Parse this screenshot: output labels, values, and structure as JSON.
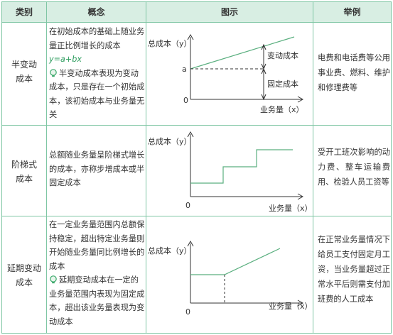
{
  "headers": {
    "category": "类别",
    "concept": "概念",
    "diagram": "图示",
    "example": "举例"
  },
  "rows": [
    {
      "category": [
        "半变动",
        "成本"
      ],
      "concept": "在初始成本的基础上随业务量正比例增长的成本",
      "formula": "y=a+bx",
      "tip": "半变动成本表现为变动成本，只是存在一个初始成本，该初始成本与业务量无关",
      "diagram": {
        "y_label": "总成本（y）",
        "x_label": "业务量（x）",
        "origin": "0",
        "intercept": "a",
        "upper_annotation": "变动成本",
        "lower_annotation": "固定成本"
      },
      "example": "电费和电话费等公用事业费、燃料、维护和修理费等"
    },
    {
      "category": [
        "阶梯式",
        "成本"
      ],
      "concept": "总额随业务量呈阶梯式增长的成本，亦称步增成本或半固定成本",
      "diagram": {
        "y_label": "总成本（y）",
        "x_label": "业务量（x）",
        "origin": "0"
      },
      "example": "受开工班次影响的动力费、整车运输费用、检验人员工资等"
    },
    {
      "category": [
        "延期变动",
        "成本"
      ],
      "concept": "在一定业务量范围内总额保持稳定，超出特定业务量则开始随业务量同比例增长的成本",
      "tip": "延期变动成本在一定的业务量范围内表现为固定成本，超出该业务量表现为变动成本",
      "diagram": {
        "y_label": "总成本（y）",
        "x_label": "业务量（x）",
        "origin": "0"
      },
      "example": "在正常业务量情况下给员工支付固定月工资，当业务量超过正常水平后则需支付加班费的人工成本"
    }
  ],
  "colors": {
    "border": "#7fc6a4",
    "header_bg": "#d8eee3",
    "formula": "#2e9d5f",
    "tip_icon": "#3aa86a"
  }
}
